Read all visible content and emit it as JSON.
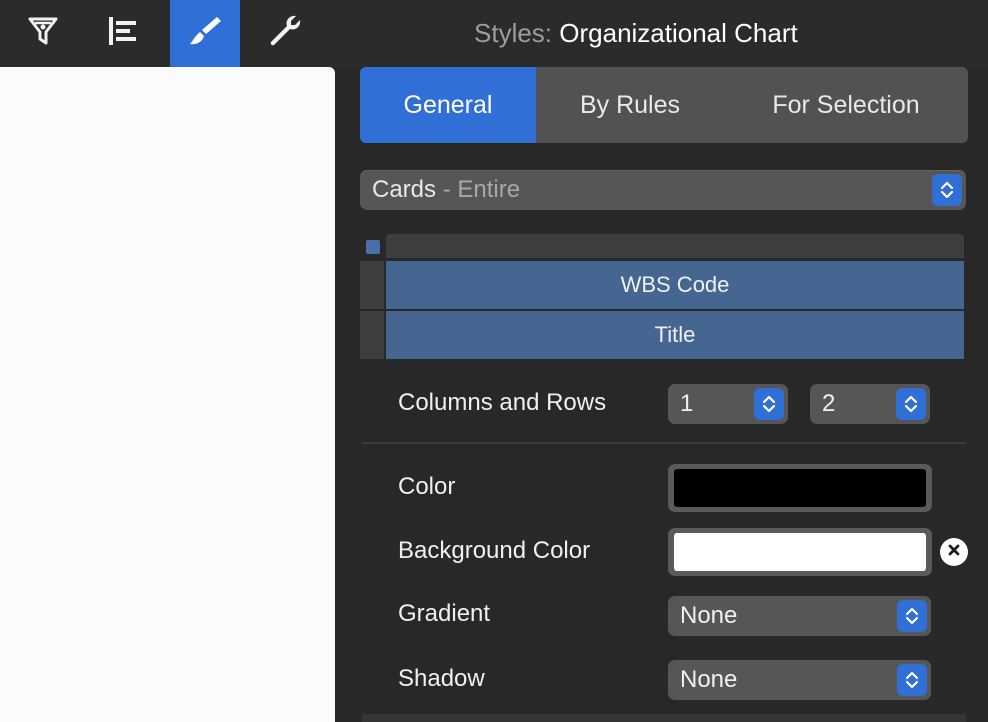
{
  "toolbar": {
    "buttons": [
      {
        "icon": "filter-icon",
        "active": false
      },
      {
        "icon": "outline-icon",
        "active": false
      },
      {
        "icon": "style-brush-icon",
        "active": true
      },
      {
        "icon": "wrench-icon",
        "active": false
      }
    ],
    "styles_prefix": "Styles:",
    "styles_name": "Organizational Chart"
  },
  "tabs": [
    {
      "label": "General",
      "active": true
    },
    {
      "label": "By Rules",
      "active": false
    },
    {
      "label": "For Selection",
      "active": false
    }
  ],
  "target": {
    "main": "Cards",
    "separator": " - ",
    "sub": "Entire"
  },
  "card_fields": [
    "WBS Code",
    "Title"
  ],
  "columns_rows": {
    "label": "Columns and Rows",
    "columns": "1",
    "rows": "2"
  },
  "color": {
    "label": "Color",
    "value": "#000000"
  },
  "background_color": {
    "label": "Background Color",
    "value": "#ffffff"
  },
  "gradient": {
    "label": "Gradient",
    "value": "None"
  },
  "shadow": {
    "label": "Shadow",
    "value": "None"
  },
  "colors": {
    "accent": "#2f6fd6",
    "row_fill": "#456690",
    "panel": "#282828",
    "canvas": "#fbfbfb"
  }
}
